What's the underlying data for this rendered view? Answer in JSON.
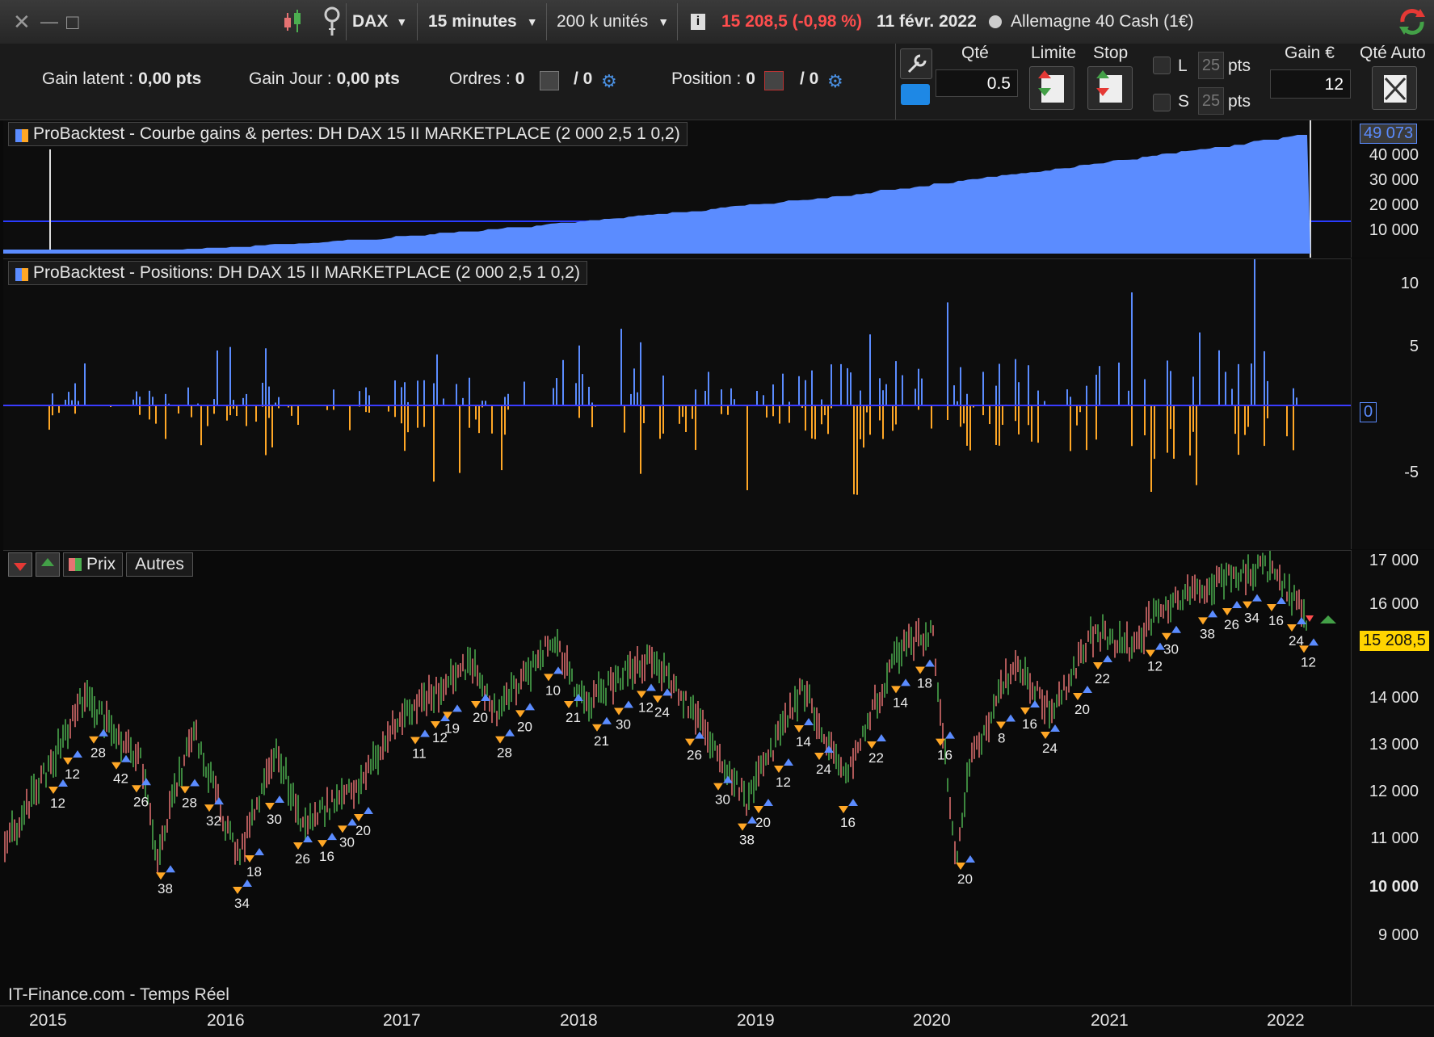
{
  "toolbar": {
    "close_glyph": "✕",
    "minimize_glyph": "—",
    "maximize_glyph": "□",
    "instrument": "DAX",
    "timeframe": "15 minutes",
    "units": "200 k unités",
    "info_glyph": "i",
    "price_change": "15 208,5 (-0,98 %)",
    "date": "11 févr. 2022",
    "market_name": "Allemagne 40 Cash (1€)"
  },
  "account_bar": {
    "gain_latent_label": "Gain latent :",
    "gain_latent_value": "0,00 pts",
    "gain_jour_label": "Gain Jour :",
    "gain_jour_value": "0,00 pts",
    "ordres_label": "Ordres :",
    "ordres_value": "0",
    "ordres_slash": "/ 0",
    "position_label": "Position :",
    "position_value": "0",
    "position_slash": "/ 0"
  },
  "order_panel": {
    "qte_label": "Qté",
    "qte_value": "0.5",
    "limite_label": "Limite",
    "stop_label": "Stop",
    "l_label": "L",
    "s_label": "S",
    "l_pts": "25",
    "s_pts": "25",
    "pts_label": "pts",
    "gain_label": "Gain €",
    "gain_value": "12",
    "qte_auto_label": "Qté Auto"
  },
  "equity_panel": {
    "legend": "ProBacktest - Courbe gains & pertes: DH DAX 15 II MARKETPLACE (2 000 2,5 1 0,2)",
    "last_value_label": "49 073",
    "ticks": [
      "40 000",
      "30 000",
      "20 000",
      "10 000"
    ]
  },
  "positions_panel": {
    "legend": "ProBacktest - Positions: DH DAX 15 II MARKETPLACE (2 000 2,5 1 0,2)",
    "zero_label": "0",
    "ticks": [
      "10",
      "5",
      "-5"
    ]
  },
  "price_panel": {
    "tab_prix": "Prix",
    "tab_autres": "Autres",
    "last_price_label": "15 208,5",
    "ticks": [
      "17 000",
      "16 000",
      "14 000",
      "13 000",
      "12 000",
      "11 000",
      "10 000",
      "9 000"
    ],
    "watermark": "IT-Finance.com - Temps Réel",
    "trade_labels": [
      "12",
      "12",
      "28",
      "42",
      "26",
      "38",
      "28",
      "32",
      "34",
      "18",
      "30",
      "26",
      "16",
      "30",
      "20",
      "11",
      "12",
      "19",
      "20",
      "28",
      "20",
      "10",
      "21",
      "21",
      "30",
      "12",
      "24",
      "26",
      "30",
      "38",
      "20",
      "12",
      "14",
      "24",
      "16",
      "22",
      "14",
      "18",
      "16",
      "20",
      "8",
      "16",
      "24",
      "20",
      "22",
      "12",
      "30",
      "38",
      "26",
      "34",
      "16",
      "24",
      "12"
    ]
  },
  "years": [
    "2015",
    "2016",
    "2017",
    "2018",
    "2019",
    "2020",
    "2021",
    "2022"
  ],
  "colors": {
    "equity_blue": "#5b8cff",
    "position_orange": "#ffa726",
    "candle_green": "#4caf50",
    "candle_red": "#e57373",
    "price_red": "#ff4d4d",
    "last_price_yellow": "#ffd400"
  }
}
